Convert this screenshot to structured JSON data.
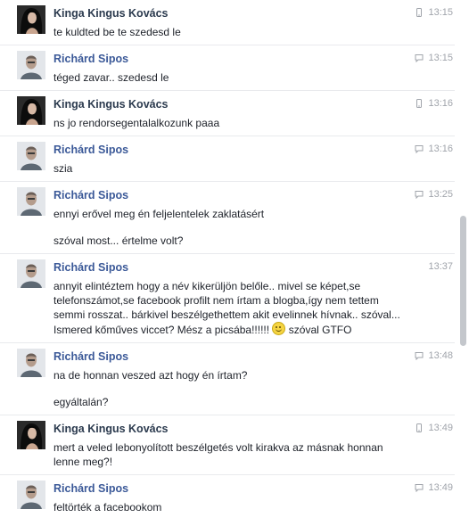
{
  "messages": [
    {
      "sender": "Kinga Kingus Kovács",
      "avatar": "woman-dark-hair",
      "device": "mobile-icon",
      "time": "13:15",
      "lines": [
        "te kuldted be te szedesd le"
      ]
    },
    {
      "sender": "Richárd Sipos",
      "avatar": "man-portrait",
      "device": "chat-icon",
      "time": "13:15",
      "lines": [
        "téged zavar.. szedesd le"
      ]
    },
    {
      "sender": "Kinga Kingus Kovács",
      "avatar": "woman-dark-hair",
      "device": "mobile-icon",
      "time": "13:16",
      "lines": [
        "ns jo rendorsegentalalkozunk paaa"
      ]
    },
    {
      "sender": "Richárd Sipos",
      "avatar": "man-portrait",
      "device": "chat-icon",
      "time": "13:16",
      "lines": [
        "szia"
      ]
    },
    {
      "sender": "Richárd Sipos",
      "avatar": "man-portrait",
      "device": "chat-icon",
      "time": "13:25",
      "lines": [
        "ennyi erővel meg én feljelentelek zaklatásért",
        "szóval most... értelme volt?"
      ]
    },
    {
      "sender": "Richárd Sipos",
      "avatar": "man-portrait",
      "device": "",
      "time": "13:37",
      "lines": [
        "annyit elintéztem hogy a név kikerüljön belőle.. mivel se képet,se telefonszámot,se facebook profilt nem írtam a blogba,így nem tettem semmi rosszat.. bárkivel beszélgethettem akit  evelinnek hívnak.. szóval... Ismered  kőműves viccet? Mész a picsába!!!!!! [smile] szóval GTFO"
      ]
    },
    {
      "sender": "Richárd Sipos",
      "avatar": "man-portrait",
      "device": "chat-icon",
      "time": "13:48",
      "lines": [
        "na de honnan veszed azt hogy én írtam?",
        "egyáltalán?"
      ]
    },
    {
      "sender": "Kinga Kingus Kovács",
      "avatar": "woman-dark-hair",
      "device": "mobile-icon",
      "time": "13:49",
      "lines": [
        "mert a veled lebonyolított beszélgetés volt kirakva az másnak honnan lenne meg?!"
      ]
    },
    {
      "sender": "Richárd Sipos",
      "avatar": "man-portrait",
      "device": "chat-icon",
      "time": "13:49",
      "lines": [
        "feltörték a facebookom"
      ]
    }
  ],
  "colors": {
    "name_link": "#3b5998",
    "name_dark": "#2b3a4e",
    "timestamp": "#a0a4ab",
    "divider": "#e9eaed",
    "scrollbar": "#c4c7cc"
  },
  "emoji": {
    "smile": "smiley-emoji-icon"
  }
}
